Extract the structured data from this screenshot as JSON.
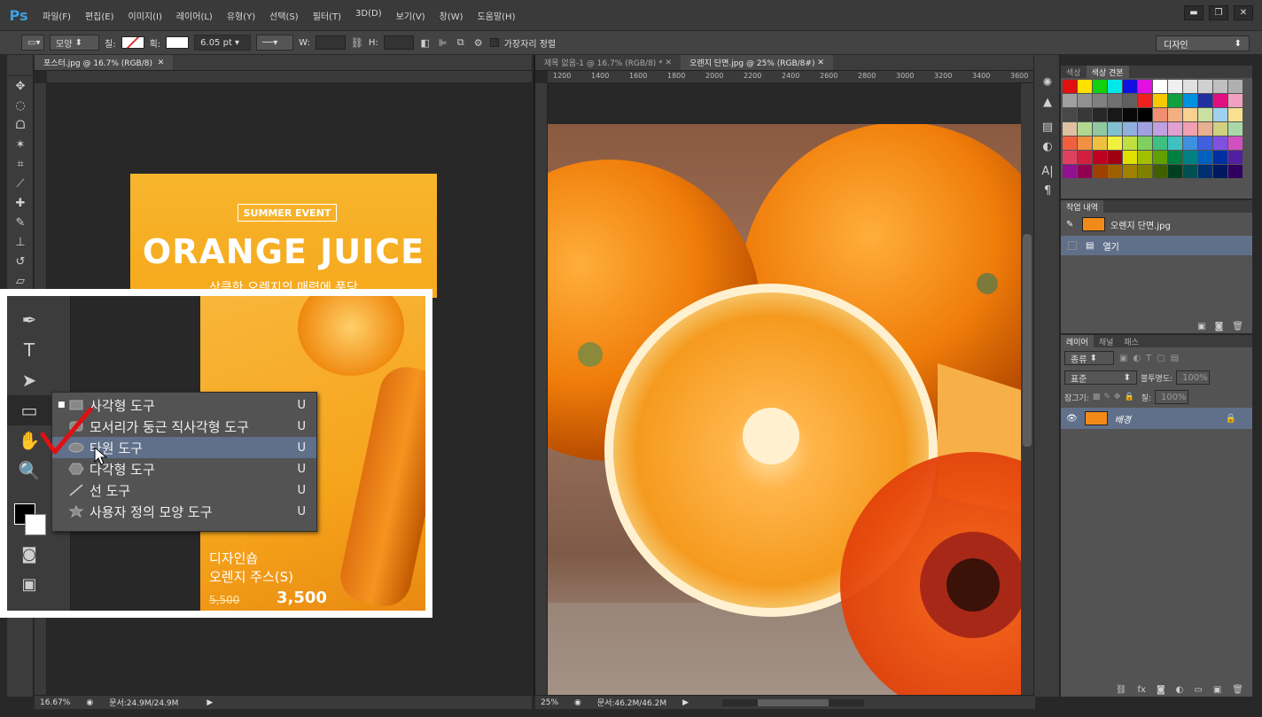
{
  "app": {
    "logo": "Ps"
  },
  "menubar": {
    "items": [
      "파일(F)",
      "편집(E)",
      "이미지(I)",
      "레이어(L)",
      "유형(Y)",
      "선택(S)",
      "필터(T)",
      "3D(D)",
      "보기(V)",
      "창(W)",
      "도움말(H)"
    ],
    "window_buttons": [
      "▬",
      "❐",
      "✕"
    ]
  },
  "options_bar": {
    "mode_select": "모양",
    "fill_label": "칠:",
    "stroke_label": "획:",
    "stroke_width": "6.05 pt",
    "w_label": "W:",
    "h_label": "H:",
    "align_edges_label": "가장자리 정렬",
    "workspace": "디자인"
  },
  "docs": {
    "left": {
      "tab": "포스터.jpg @ 16.7% (RGB/8)",
      "zoom": "16.67%",
      "doc_size": "문서:24.9M/24.9M",
      "poster": {
        "event": "SUMMER EVENT",
        "title": "ORANGE JUICE",
        "subtitle": "상큼한 오렌지의 매력에 풍당",
        "brand": "디자인숍",
        "product": "오렌지 주스(S)",
        "price": "3,500",
        "price_old": "5,500"
      }
    },
    "right": {
      "tabs": [
        "제목 없음-1 @ 16.7% (RGB/8) *",
        "오렌지 단면.jpg @ 25% (RGB/8#)"
      ],
      "zoom": "25%",
      "doc_size": "문서:46.2M/46.2M",
      "ruler_h": [
        "1200",
        "1400",
        "1600",
        "1800",
        "2000",
        "2200",
        "2400",
        "2600",
        "2800",
        "3000",
        "3200",
        "3400",
        "3600"
      ]
    }
  },
  "tool_flyout": {
    "items": [
      {
        "label": "사각형 도구",
        "key": "U",
        "icon": "rectangle-icon",
        "active": true
      },
      {
        "label": "모서리가 둥근 직사각형 도구",
        "key": "U",
        "icon": "rounded-rectangle-icon"
      },
      {
        "label": "타원 도구",
        "key": "U",
        "icon": "ellipse-icon",
        "highlighted": true
      },
      {
        "label": "다각형 도구",
        "key": "U",
        "icon": "polygon-icon"
      },
      {
        "label": "선 도구",
        "key": "U",
        "icon": "line-icon"
      },
      {
        "label": "사용자 정의 모양 도구",
        "key": "U",
        "icon": "custom-shape-icon"
      }
    ]
  },
  "panels": {
    "swatches": {
      "tabs": [
        "색상",
        "색상 견본"
      ]
    },
    "history": {
      "tab": "작업 내역",
      "snapshot": "오렌지 단면.jpg",
      "items": [
        "열기"
      ]
    },
    "layers": {
      "tabs": [
        "레이어",
        "채널",
        "패스"
      ],
      "filter": "종류",
      "blend_mode": "표준",
      "opacity_label": "불투명도:",
      "opacity": "100%",
      "lock_label": "잠그기:",
      "fill_label": "칠:",
      "fill": "100%",
      "layer_name": "배경"
    }
  }
}
